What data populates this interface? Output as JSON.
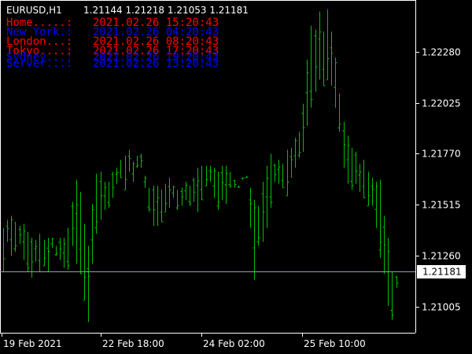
{
  "header": {
    "symbol_timeframe": "EURUSD,H1",
    "quote": "1.21144 1.21218 1.21053 1.21181"
  },
  "clocks": [
    {
      "label": "Home.....:",
      "time": "2021.02.26 15:20:43",
      "color": "#ff0000"
    },
    {
      "label": "New York.:",
      "time": "2021.02.26 04:20:43",
      "color": "#0000ff"
    },
    {
      "label": "London...:",
      "time": "2021.02.26 08:20:43",
      "color": "#ff0000"
    },
    {
      "label": "Tokyo....:",
      "time": "2021.02.26 17:20:43",
      "color": "#ff0000"
    },
    {
      "label": "Sydney...:",
      "time": "2021.02.26 19:20:43",
      "color": "#0000ff"
    },
    {
      "label": "Server...:",
      "time": "2021.02.26 13:20:43",
      "color": "#0000ff"
    }
  ],
  "current_price": {
    "label": "1.21181",
    "value": 1.21181,
    "line_color": "#8aa2b8"
  },
  "colors": {
    "bars": "#00c000",
    "background": "#000000",
    "foreground": "#ffffff"
  },
  "chart_data": {
    "type": "ohlc",
    "ylim": [
      1.2088,
      1.2253
    ],
    "yticks": [
      1.2228,
      1.22025,
      1.2177,
      1.21515,
      1.2126,
      1.21005
    ],
    "ytick_labels": [
      "1.22280",
      "1.22025",
      "1.21770",
      "1.21515",
      "1.21260",
      "1.21005"
    ],
    "xlabels": [
      "19 Feb 2021",
      "22 Feb 18:00",
      "24 Feb 02:00",
      "25 Feb 10:00"
    ],
    "bars_low": [
      1.2118,
      1.2133,
      1.2126,
      1.2128,
      1.2132,
      1.2124,
      1.2118,
      1.2115,
      1.2123,
      1.2118,
      1.2121,
      1.2118,
      1.213,
      1.2126,
      1.2124,
      1.212,
      1.2119,
      1.2131,
      1.2122,
      1.2117,
      1.2104,
      1.2093,
      1.2122,
      1.2137,
      1.2144,
      1.2149,
      1.215,
      1.2155,
      1.2162,
      1.2165,
      1.2159,
      1.2168,
      1.2163,
      1.217,
      1.217,
      1.216,
      1.2148,
      1.2141,
      1.2141,
      1.2143,
      1.2148,
      1.215,
      1.2155,
      1.2149,
      1.2151,
      1.2154,
      1.2151,
      1.2153,
      1.2148,
      1.2154,
      1.2161,
      1.2163,
      1.2155,
      1.2149,
      1.2154,
      1.2152,
      1.216,
      1.216,
      1.2161,
      1.2165,
      1.2165,
      1.214,
      1.2114,
      1.2131,
      1.2133,
      1.214,
      1.215,
      1.2163,
      1.2162,
      1.216,
      1.2156,
      1.2165,
      1.217,
      1.2175,
      1.2178,
      1.2191,
      1.22,
      1.2208,
      1.2214,
      1.2211,
      1.2214,
      1.2211,
      1.22,
      1.2188,
      1.217,
      1.2162,
      1.2159,
      1.2162,
      1.2158,
      1.2155,
      1.2151,
      1.2151,
      1.214,
      1.2125,
      1.2117,
      1.2101,
      1.2094,
      1.211
    ],
    "bars_high": [
      1.214,
      1.2144,
      1.2146,
      1.2143,
      1.2141,
      1.2142,
      1.2138,
      1.2135,
      1.2134,
      1.2137,
      1.2134,
      1.2135,
      1.2135,
      1.2131,
      1.2135,
      1.2135,
      1.214,
      1.2153,
      1.2164,
      1.2158,
      1.2142,
      1.2131,
      1.2152,
      1.2167,
      1.2168,
      1.2163,
      1.2163,
      1.2168,
      1.217,
      1.2174,
      1.2176,
      1.2179,
      1.2173,
      1.2176,
      1.2177,
      1.2166,
      1.216,
      1.2161,
      1.2161,
      1.2159,
      1.2162,
      1.2165,
      1.2161,
      1.2159,
      1.216,
      1.2163,
      1.2161,
      1.2165,
      1.217,
      1.2171,
      1.2171,
      1.2171,
      1.217,
      1.2168,
      1.2171,
      1.2171,
      1.2168,
      1.2164,
      1.216,
      1.2164,
      1.2166,
      1.216,
      1.2154,
      1.2151,
      1.2163,
      1.2171,
      1.2177,
      1.2172,
      1.2174,
      1.2172,
      1.2179,
      1.218,
      1.2185,
      1.2188,
      1.2202,
      1.2224,
      1.2241,
      1.2239,
      1.2248,
      1.2238,
      1.2249,
      1.2238,
      1.2225,
      1.2207,
      1.2193,
      1.2186,
      1.218,
      1.2178,
      1.2172,
      1.2174,
      1.2168,
      1.2165,
      1.2163,
      1.2164,
      1.2146,
      1.2135,
      1.2118,
      1.2116
    ]
  }
}
